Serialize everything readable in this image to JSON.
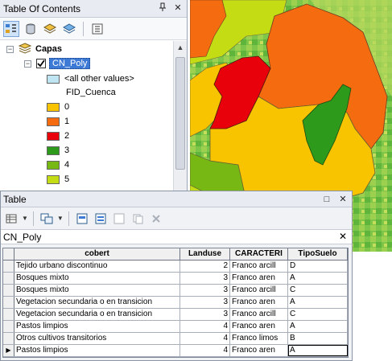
{
  "toc": {
    "title": "Table Of Contents",
    "pin_glyph": "ᵠ",
    "close_glyph": "✕",
    "toolbar": [
      {
        "icon": "list-by-drawing-order-icon"
      },
      {
        "icon": "list-by-source-icon"
      },
      {
        "icon": "list-by-visibility-icon"
      },
      {
        "icon": "list-by-selection-icon"
      },
      {
        "icon": "options-icon"
      }
    ],
    "tree": {
      "group": {
        "label": "Capas",
        "expanded_glyph": "−"
      },
      "layer": {
        "label": "CN_Poly",
        "checked": true,
        "expanded_glyph": "−"
      },
      "other_values_label": "<all other values>",
      "field_label": "FID_Cuenca",
      "classes": [
        {
          "label": "0",
          "color": "#f8c400"
        },
        {
          "label": "1",
          "color": "#f46b10"
        },
        {
          "label": "2",
          "color": "#e8000a"
        },
        {
          "label": "3",
          "color": "#2e9a1c"
        },
        {
          "label": "4",
          "color": "#78b814"
        },
        {
          "label": "5",
          "color": "#c4dc14"
        }
      ],
      "other_values_color": "#bfe4f2"
    }
  },
  "table_window": {
    "title": "Table",
    "restore_glyph": "□",
    "close_glyph": "✕",
    "layer_tab": {
      "label": "CN_Poly",
      "close_glyph": "✕"
    },
    "columns": [
      "cobert",
      "Landuse",
      "CARACTERI",
      "TipoSuelo"
    ],
    "rows": [
      {
        "cobert": "Tejido urbano discontinuo",
        "landuse": "2",
        "caracteri": "Franco arcill",
        "tipo": "D"
      },
      {
        "cobert": "Bosques mixto",
        "landuse": "3",
        "caracteri": "Franco aren",
        "tipo": "A"
      },
      {
        "cobert": "Bosques mixto",
        "landuse": "3",
        "caracteri": "Franco arcill",
        "tipo": "C"
      },
      {
        "cobert": "Vegetacion secundaria o en transicion",
        "landuse": "3",
        "caracteri": "Franco aren",
        "tipo": "A"
      },
      {
        "cobert": "Vegetacion secundaria o en transicion",
        "landuse": "3",
        "caracteri": "Franco arcill",
        "tipo": "C"
      },
      {
        "cobert": "Pastos limpios",
        "landuse": "4",
        "caracteri": "Franco aren",
        "tipo": "A"
      },
      {
        "cobert": "Otros cultivos transitorios",
        "landuse": "4",
        "caracteri": "Franco limos",
        "tipo": "B"
      },
      {
        "cobert": "Pastos limpios",
        "landuse": "4",
        "caracteri": "Franco aren",
        "tipo": "A"
      }
    ],
    "current_row_marker": "▶"
  }
}
